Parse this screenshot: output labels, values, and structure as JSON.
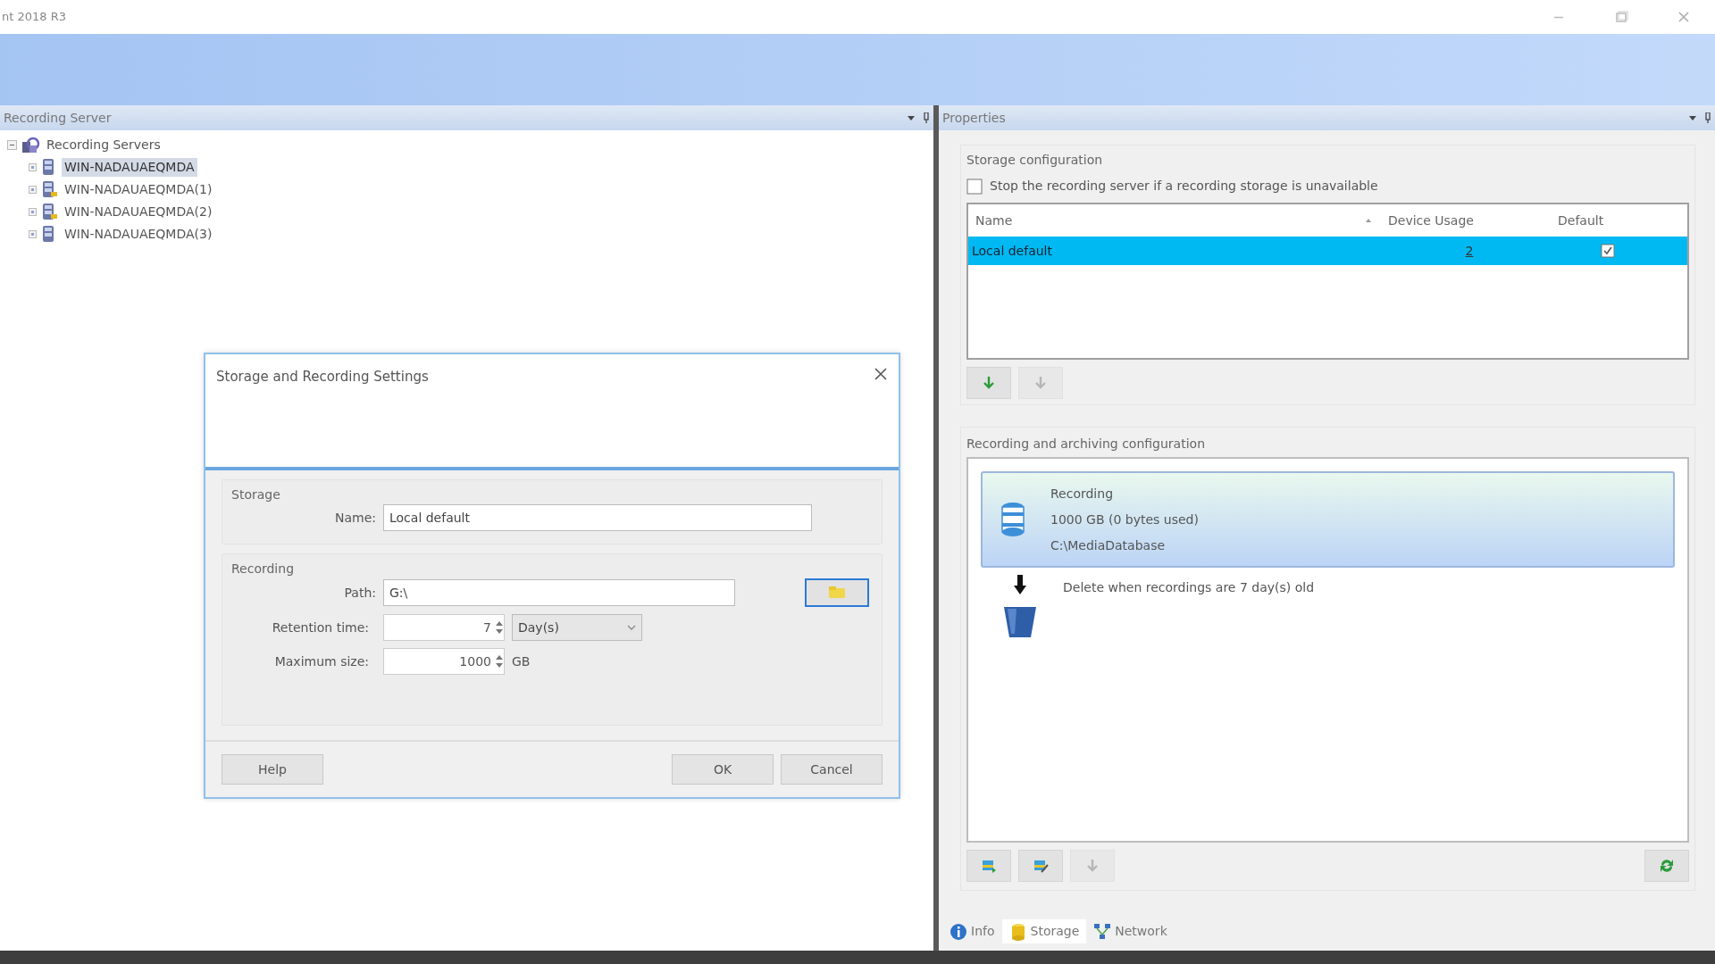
{
  "window": {
    "title": "nt 2018 R3"
  },
  "left_pane": {
    "title": "Recording Server",
    "tree": [
      {
        "label": "Recording Servers",
        "expanded": true,
        "children": [
          {
            "label": "WIN-NADAUAEQMDA",
            "selected": true,
            "warning": false
          },
          {
            "label": "WIN-NADAUAEQMDA(1)",
            "selected": false,
            "warning": true
          },
          {
            "label": "WIN-NADAUAEQMDA(2)",
            "selected": false,
            "warning": true
          },
          {
            "label": "WIN-NADAUAEQMDA(3)",
            "selected": false,
            "warning": false
          }
        ]
      }
    ]
  },
  "dialog": {
    "title": "Storage and Recording Settings",
    "storage": {
      "legend": "Storage",
      "name_label": "Name:",
      "name_value": "Local default"
    },
    "recording": {
      "legend": "Recording",
      "path_label": "Path:",
      "path_value": "G:\\",
      "retention_label": "Retention time:",
      "retention_value": "7",
      "retention_unit": "Day(s)",
      "max_size_label": "Maximum size:",
      "max_size_value": "1000",
      "max_size_unit": "GB"
    },
    "buttons": [
      {
        "label": "Help"
      },
      {
        "label": "OK"
      },
      {
        "label": "Cancel"
      }
    ]
  },
  "properties": {
    "title": "Properties",
    "storage_config": {
      "legend": "Storage configuration",
      "stop_checkbox": {
        "label": "Stop the recording server if a recording storage is unavailable",
        "checked": false
      },
      "table": {
        "columns": [
          "Name",
          "Device Usage",
          "Default"
        ],
        "rows": [
          {
            "name": "Local default",
            "device_usage": "2",
            "default": true,
            "selected": true
          }
        ]
      },
      "buttons": [
        {
          "kind": "add",
          "disabled": false
        },
        {
          "kind": "remove",
          "disabled": true
        }
      ]
    },
    "recording_config": {
      "legend": "Recording and archiving configuration",
      "recording": {
        "title": "Recording",
        "size": "1000 GB (0 bytes used)",
        "path": "C:\\MediaDatabase",
        "selected": true
      },
      "delete_rule": "Delete when recordings are 7 day(s) old",
      "buttons": [
        {
          "kind": "add-archive",
          "disabled": false
        },
        {
          "kind": "edit",
          "disabled": false
        },
        {
          "kind": "remove",
          "disabled": true
        }
      ]
    },
    "tabs": [
      {
        "label": "Info",
        "selected": false,
        "kind": "info"
      },
      {
        "label": "Storage",
        "selected": true,
        "kind": "storage"
      },
      {
        "label": "Network",
        "selected": false,
        "kind": "network"
      }
    ]
  }
}
